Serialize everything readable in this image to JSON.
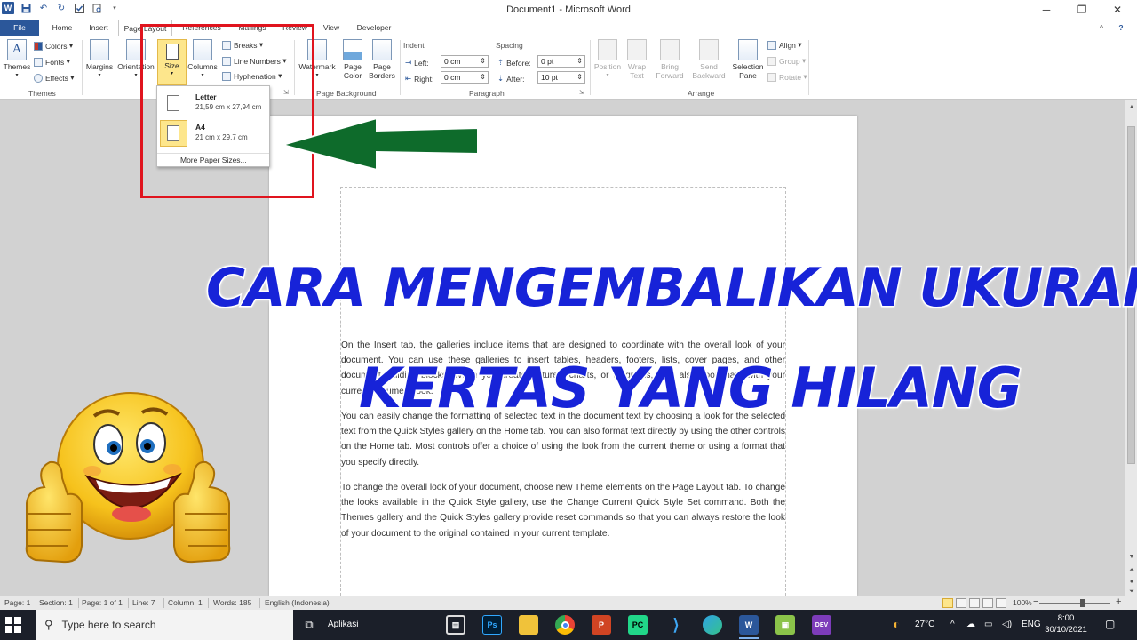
{
  "window": {
    "title": "Document1 - Microsoft Word",
    "app_badge": "W"
  },
  "tabs": [
    "File",
    "Home",
    "Insert",
    "Page Layout",
    "References",
    "Mailings",
    "Review",
    "View",
    "Developer"
  ],
  "ribbon": {
    "themes": {
      "themes": "Themes",
      "colors": "Colors",
      "fonts": "Fonts",
      "effects": "Effects",
      "group": "Themes"
    },
    "page_setup": {
      "margins": "Margins",
      "orientation": "Orientation",
      "size": "Size",
      "columns": "Columns",
      "breaks": "Breaks",
      "line_numbers": "Line Numbers",
      "hyphenation": "Hyphenation"
    },
    "page_background": {
      "watermark": "Watermark",
      "page_color": [
        "Page",
        "Color"
      ],
      "page_borders": [
        "Page",
        "Borders"
      ],
      "group": "Page Background"
    },
    "paragraph": {
      "indent": "Indent",
      "left_label": "Left:",
      "left_value": "0 cm",
      "right_label": "Right:",
      "right_value": "0 cm",
      "spacing": "Spacing",
      "before_label": "Before:",
      "before_value": "0 pt",
      "after_label": "After:",
      "after_value": "10 pt",
      "group": "Paragraph"
    },
    "arrange": {
      "position": "Position",
      "wrap_text": [
        "Wrap",
        "Text"
      ],
      "bring_forward": [
        "Bring",
        "Forward"
      ],
      "send_backward": [
        "Send",
        "Backward"
      ],
      "selection_pane": [
        "Selection",
        "Pane"
      ],
      "align": "Align",
      "group_btn": "Group",
      "rotate": "Rotate",
      "group": "Arrange"
    }
  },
  "size_dropdown": {
    "items": [
      {
        "name": "Letter",
        "dimensions": "21,59 cm x 27,94 cm",
        "selected": false
      },
      {
        "name": "A4",
        "dimensions": "21 cm x 29,7 cm",
        "selected": true
      }
    ],
    "more": "More Paper Sizes..."
  },
  "document": {
    "paragraphs": [
      "On the Insert tab, the galleries include items that are designed to coordinate with the overall look of your document. You can use these galleries to insert tables, headers, footers, lists, cover pages, and other document building blocks. When you create pictures, charts, or diagrams, they also coordinate with your current document look.",
      "You can easily change the formatting of selected text in the document text by choosing a look for the selected text from the Quick Styles gallery on the Home tab. You can also format text directly by using the other controls on the Home tab. Most controls offer a choice of using the look from the current theme or using a format that you specify directly.",
      "To change the overall look of your document, choose new Theme elements on the Page Layout tab. To change the looks available in the Quick Style gallery, use the Change Current Quick Style Set command. Both the Themes gallery and the Quick Styles gallery provide reset commands so that you can always restore the look of your document to the original contained in your current template."
    ]
  },
  "overlay": {
    "headline_1": "CARA MENGEMBALIKAN UKURAN",
    "headline_2": "KERTAS YANG HILANG",
    "arrow_color": "#0e6b2b",
    "highlight_color": "#e0141e",
    "headline_color": "#1723d8"
  },
  "statusbar": {
    "page": "Page: 1",
    "section": "Section: 1",
    "page_of": "Page: 1 of 1",
    "line": "Line: 7",
    "column": "Column: 1",
    "words": "Words: 185",
    "language": "English (Indonesia)",
    "zoom": "100%",
    "zoom_fraction": 0.6
  },
  "taskbar": {
    "search_placeholder": "Type here to search",
    "pinned_label": "Aplikasi",
    "apps": [
      "Ps",
      "PC",
      "DEV"
    ],
    "weather": "27°C",
    "language": "ENG",
    "time": "8:00",
    "date": "30/10/2021"
  }
}
